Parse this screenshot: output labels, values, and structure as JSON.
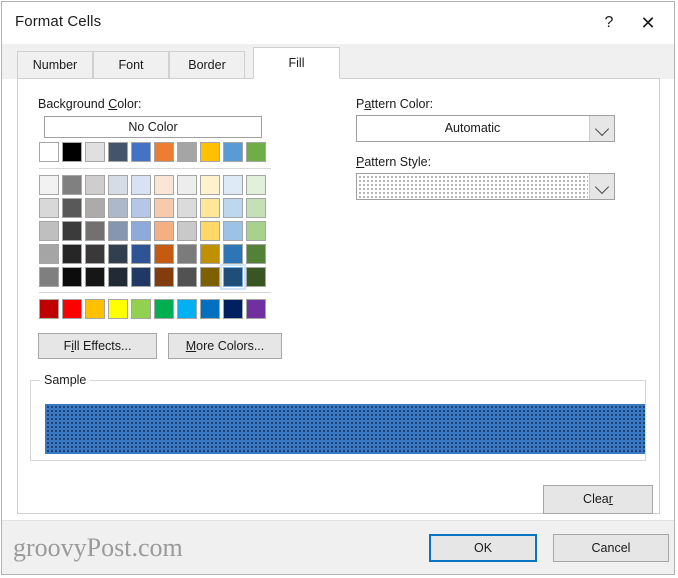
{
  "window": {
    "title": "Format Cells",
    "help_icon": "question-mark-icon",
    "close_icon": "close-icon"
  },
  "tabs": [
    {
      "label": "Number",
      "active": false
    },
    {
      "label": "Font",
      "active": false
    },
    {
      "label": "Border",
      "active": false
    },
    {
      "label": "Fill",
      "active": true
    }
  ],
  "fill_tab": {
    "background_color": {
      "label_before": "Background ",
      "label_accel": "C",
      "label_after": "olor:",
      "no_color_button": "No Color"
    },
    "pattern_color": {
      "label_before": "P",
      "label_accel": "a",
      "label_after": "ttern Color:",
      "value": "Automatic",
      "arrow_icon": "chevron-down-icon"
    },
    "pattern_style": {
      "label_before": "",
      "label_accel": "P",
      "label_after": "attern Style:",
      "value": "fine-dots-pattern",
      "arrow_icon": "chevron-down-icon"
    },
    "fill_effects_button": {
      "before": "F",
      "accel": "i",
      "after": "ll Effects..."
    },
    "more_colors_button": {
      "before": "",
      "accel": "M",
      "after": "ore Colors..."
    },
    "sample": {
      "legend": "Sample",
      "fill_color": "#3b78c3",
      "pattern_dot_color": "#15315c"
    },
    "clear_button": {
      "before": "Clea",
      "accel": "r",
      "after": ""
    }
  },
  "palette": {
    "theme_row": [
      "#ffffff",
      "#000000",
      "#e0e0e0",
      "#44546a",
      "#4472c4",
      "#ed7d31",
      "#a5a5a5",
      "#ffc000",
      "#5b9bd5",
      "#70ad47"
    ],
    "tint_rows": [
      [
        "#f2f2f2",
        "#808080",
        "#cfcdcd",
        "#d6dce5",
        "#d9e2f3",
        "#fbe5d6",
        "#ededed",
        "#fff2cc",
        "#deebf7",
        "#e2efd9"
      ],
      [
        "#d8d8d8",
        "#595959",
        "#aeaaaa",
        "#adb9ca",
        "#b4c7e7",
        "#f7caac",
        "#dbdbdb",
        "#ffe699",
        "#bdd7ee",
        "#c5e0b4"
      ],
      [
        "#bfbfbf",
        "#3b3b3b",
        "#757070",
        "#8496b0",
        "#8eaadb",
        "#f4b083",
        "#c9c9c9",
        "#ffd965",
        "#9cc3e6",
        "#a9d18e"
      ],
      [
        "#a5a5a5",
        "#262626",
        "#3a3838",
        "#323f4f",
        "#2e5496",
        "#c55a11",
        "#7b7b7b",
        "#bf9000",
        "#2e75b5",
        "#538135"
      ],
      [
        "#7f7f7f",
        "#0c0c0c",
        "#171616",
        "#222a35",
        "#1f3864",
        "#833c0b",
        "#525252",
        "#7f6000",
        "#1f4e79",
        "#375623"
      ]
    ],
    "standard_row": [
      "#c00000",
      "#ff0000",
      "#ffc000",
      "#ffff00",
      "#92d050",
      "#00b050",
      "#00b0f0",
      "#0070c0",
      "#002060",
      "#7030a0"
    ],
    "selected": {
      "row": 4,
      "col": 9,
      "color": "#2e75b5"
    }
  },
  "footer": {
    "watermark": "groovyPost.com",
    "ok_button": "OK",
    "cancel_button": "Cancel"
  }
}
